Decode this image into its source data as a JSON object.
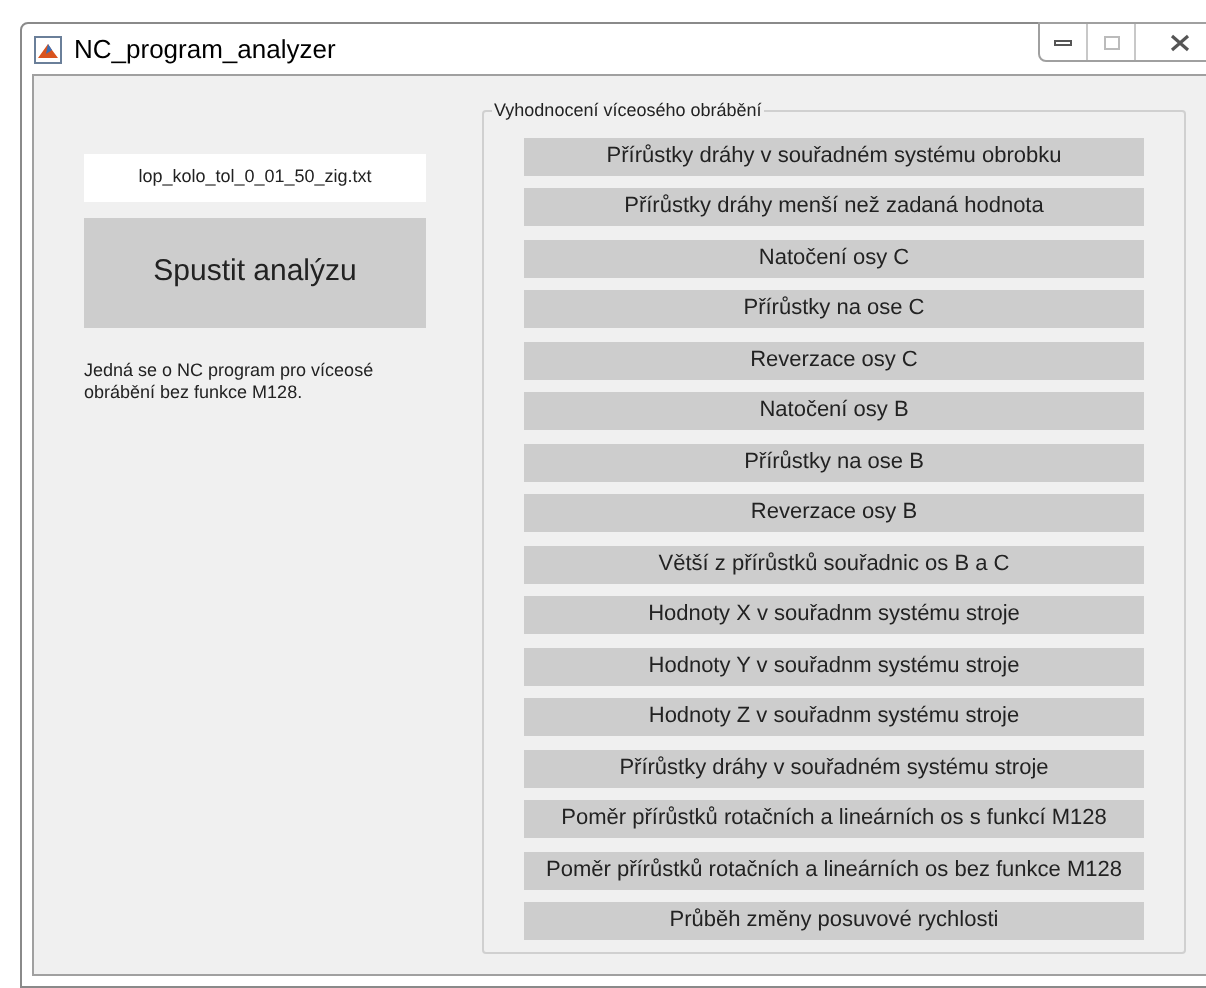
{
  "window": {
    "title": "NC_program_analyzer"
  },
  "file_field": {
    "value": "lop_kolo_tol_0_01_50_zig.txt"
  },
  "run_button": "Spustit analýzu",
  "info_text": "Jedná se o NC program pro víceosé obrábění bez funkce M128.",
  "panel": {
    "title": "Vyhodnocení víceosého obrábění",
    "buttons": [
      "Přírůstky dráhy v souřadném systému obrobku",
      "Přírůstky dráhy menší než zadaná hodnota",
      "Natočení osy C",
      "Přírůstky na ose C",
      "Reverzace osy C",
      "Natočení osy B",
      "Přírůstky na ose B",
      "Reverzace osy B",
      "Větší z přírůstků souřadnic os B a C",
      "Hodnoty X v souřadnm systému stroje",
      "Hodnoty Y v souřadnm systému stroje",
      "Hodnoty Z v souřadnm systému stroje",
      "Přírůstky dráhy v souřadném systému stroje",
      "Poměr přírůstků rotačních a lineárních os s funkcí M128",
      "Poměr přírůstků rotačních a lineárních os bez funkce M128",
      "Průběh změny posuvové rychlosti"
    ]
  }
}
